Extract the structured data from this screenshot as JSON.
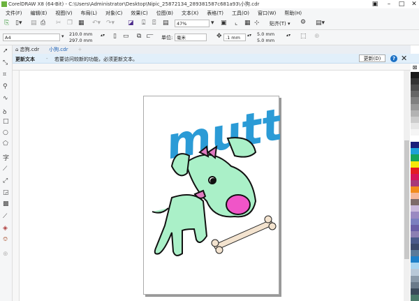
{
  "window": {
    "title": "CorelDRAW X8 (64-Bit) - C:\\Users\\Administrator\\Desktop\\Nipic_25872134_289381587c681a93\\小狗.cdr"
  },
  "menu": [
    "文件(F)",
    "编辑(E)",
    "视图(V)",
    "布局(L)",
    "对象(C)",
    "效果(C)",
    "位图(B)",
    "文本(X)",
    "表格(T)",
    "工具(O)",
    "窗口(W)",
    "帮助(H)"
  ],
  "toolbar": {
    "zoom": "47%",
    "snap": "贴齐(T)"
  },
  "property_bar": {
    "page_size": "A4",
    "width": "210.0 mm",
    "height": "297.0 mm",
    "units_label": "单位:",
    "units": "毫米",
    "nudge": ".1 mm",
    "dup_x": "5.0 mm",
    "dup_y": "5.0 mm"
  },
  "tabs": [
    {
      "label": "恋狗.cdr"
    },
    {
      "label": "小狗.cdr"
    }
  ],
  "notice": {
    "title": "更新文本",
    "message": "若要访问较新的功能，必须更新文本。",
    "button": "更新(D)"
  },
  "artwork": {
    "text": "mutt",
    "text_color": "#2b9bd6",
    "dog_color": "#aaf0c8"
  },
  "palette": [
    "#1a1a1a",
    "#333333",
    "#4d4d4d",
    "#666666",
    "#808080",
    "#999999",
    "#b3b3b3",
    "#cccccc",
    "#e6e6e6",
    "#f5f5f5",
    "#ffffff",
    "#1b1f7a",
    "#1ea0d8",
    "#16a35a",
    "#f5e90a",
    "#e31b23",
    "#d4145a",
    "#a63a79",
    "#f28c1c",
    "#f6b89a",
    "#7d6b6b",
    "#c9b8dc",
    "#9a89c2",
    "#7b7fbf",
    "#6a5fa6",
    "#8c7fb3",
    "#4a5a8a",
    "#3b4a6b",
    "#5a7a9a",
    "#1e7fc8",
    "#a8d4f0",
    "#b8c8d8",
    "#8a9aaa",
    "#6a7a8a",
    "#3a4a5a",
    "#4a7a6a"
  ]
}
